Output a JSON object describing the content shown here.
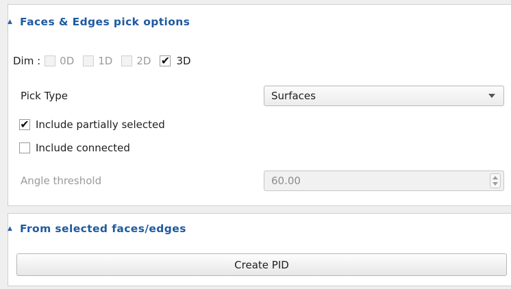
{
  "pick_options": {
    "title": "Faces & Edges pick options",
    "collapse_icon": "chevron-up-icon",
    "dim": {
      "label": "Dim :",
      "options": [
        {
          "label": "0D",
          "checked": false,
          "enabled": false
        },
        {
          "label": "1D",
          "checked": false,
          "enabled": false
        },
        {
          "label": "2D",
          "checked": false,
          "enabled": false
        },
        {
          "label": "3D",
          "checked": true,
          "enabled": true
        }
      ]
    },
    "pick_type": {
      "label": "Pick Type",
      "value": "Surfaces"
    },
    "include_partially_selected": {
      "label": "Include partially selected",
      "checked": true
    },
    "include_connected": {
      "label": "Include connected",
      "checked": false
    },
    "angle_threshold": {
      "label": "Angle threshold",
      "value": "60.00",
      "enabled": false
    }
  },
  "from_selected": {
    "title": "From selected faces/edges",
    "collapse_icon": "chevron-up-icon",
    "create_button_label": "Create PID"
  },
  "colors": {
    "header_text": "#1e5aa0",
    "disabled_text": "#9a9a9a",
    "panel_bg": "#ffffff",
    "window_bg": "#efefef"
  },
  "check_mark": "✔"
}
